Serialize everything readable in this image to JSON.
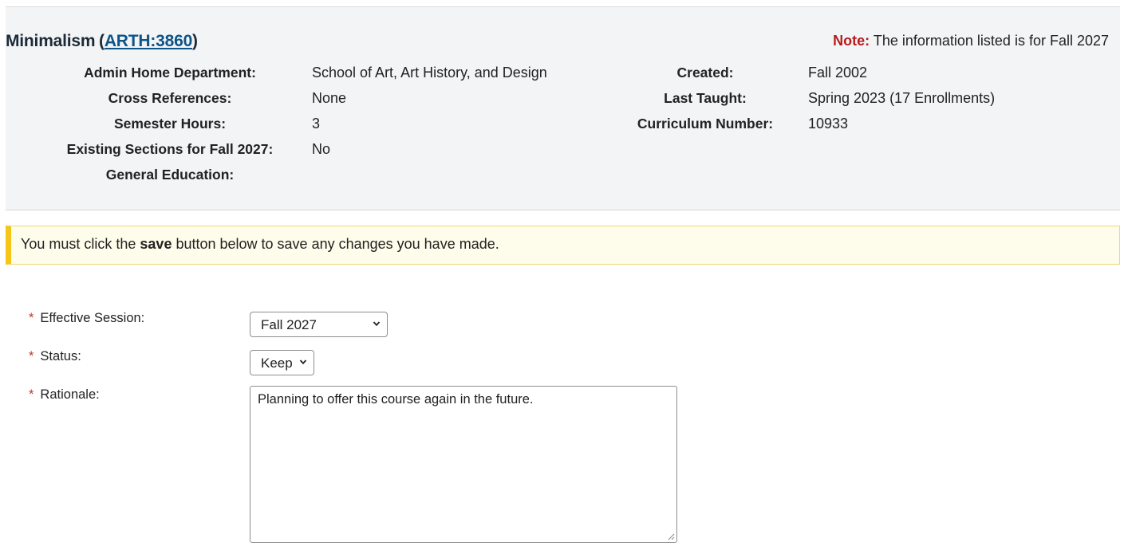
{
  "course": {
    "name": "Minimalism",
    "open_paren": "(",
    "code": "ARTH:3860",
    "close_paren": ")"
  },
  "note": {
    "label": "Note:",
    "text": "The information listed is for Fall 2027"
  },
  "details_left": [
    {
      "label": "Admin Home Department:",
      "value": "School of Art, Art History, and Design"
    },
    {
      "label": "Cross References:",
      "value": "None"
    },
    {
      "label": "Semester Hours:",
      "value": "3"
    },
    {
      "label": "Existing Sections for Fall 2027:",
      "value": "No"
    },
    {
      "label": "General Education:",
      "value": ""
    }
  ],
  "details_right": [
    {
      "label": "Created:",
      "value": "Fall 2002"
    },
    {
      "label": "Last Taught:",
      "value": "Spring 2023 (17 Enrollments)"
    },
    {
      "label": "Curriculum Number:",
      "value": "10933"
    }
  ],
  "alert": {
    "before": "You must click the ",
    "bold": "save",
    "after": " button below to save any changes you have made."
  },
  "form": {
    "required_mark": "*",
    "effective_session": {
      "label": "Effective Session:",
      "value": "Fall 2027"
    },
    "status": {
      "label": "Status:",
      "value": "Keep"
    },
    "rationale": {
      "label": "Rationale:",
      "value": "Planning to offer this course again in the future."
    }
  },
  "icons": {
    "dropdown": "chevron-down-icon",
    "resize": "resize-grip-icon"
  },
  "colors": {
    "panel_bg": "#f3f4f6",
    "link": "#0e5487",
    "note_label": "#b51d1d",
    "alert_bg": "#fefcea",
    "alert_accent": "#f5c518",
    "required": "#c0392b"
  }
}
